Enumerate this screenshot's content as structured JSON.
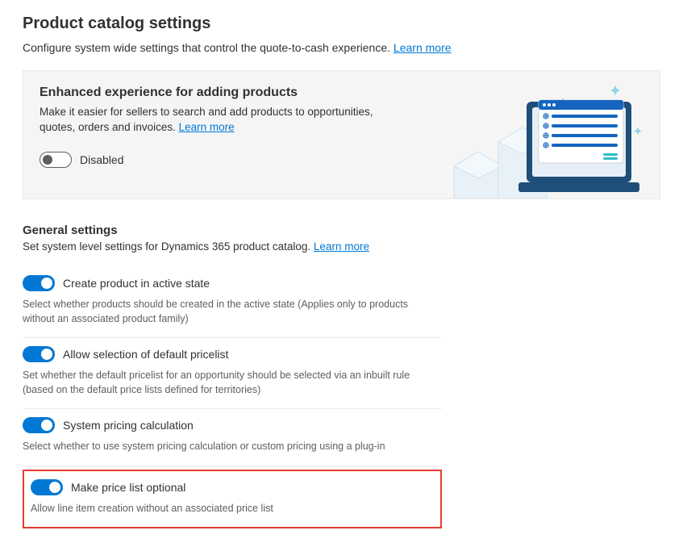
{
  "page": {
    "title": "Product catalog settings",
    "subtitle": "Configure system wide settings that control the quote-to-cash experience. ",
    "learn_more": "Learn more"
  },
  "enhanced": {
    "title": "Enhanced experience for adding products",
    "desc_part1": "Make it easier for sellers to search and add products to opportunities, quotes, orders and invoices. ",
    "learn_more": "Learn more",
    "toggle_label": "Disabled"
  },
  "general": {
    "title": "General settings",
    "desc": "Set system level settings for Dynamics 365 product catalog. ",
    "learn_more": "Learn more",
    "settings": [
      {
        "label": "Create product in active state",
        "help": "Select whether products should be created in the active state (Applies only to products without an associated product family)"
      },
      {
        "label": "Allow selection of default pricelist",
        "help": "Set whether the default pricelist for an opportunity should be selected via an inbuilt rule (based on the default price lists defined for territories)"
      },
      {
        "label": "System pricing calculation",
        "help": "Select whether to use system pricing calculation or custom pricing using a plug-in"
      },
      {
        "label": "Make price list optional",
        "help": "Allow line item creation without an associated price list"
      }
    ]
  }
}
